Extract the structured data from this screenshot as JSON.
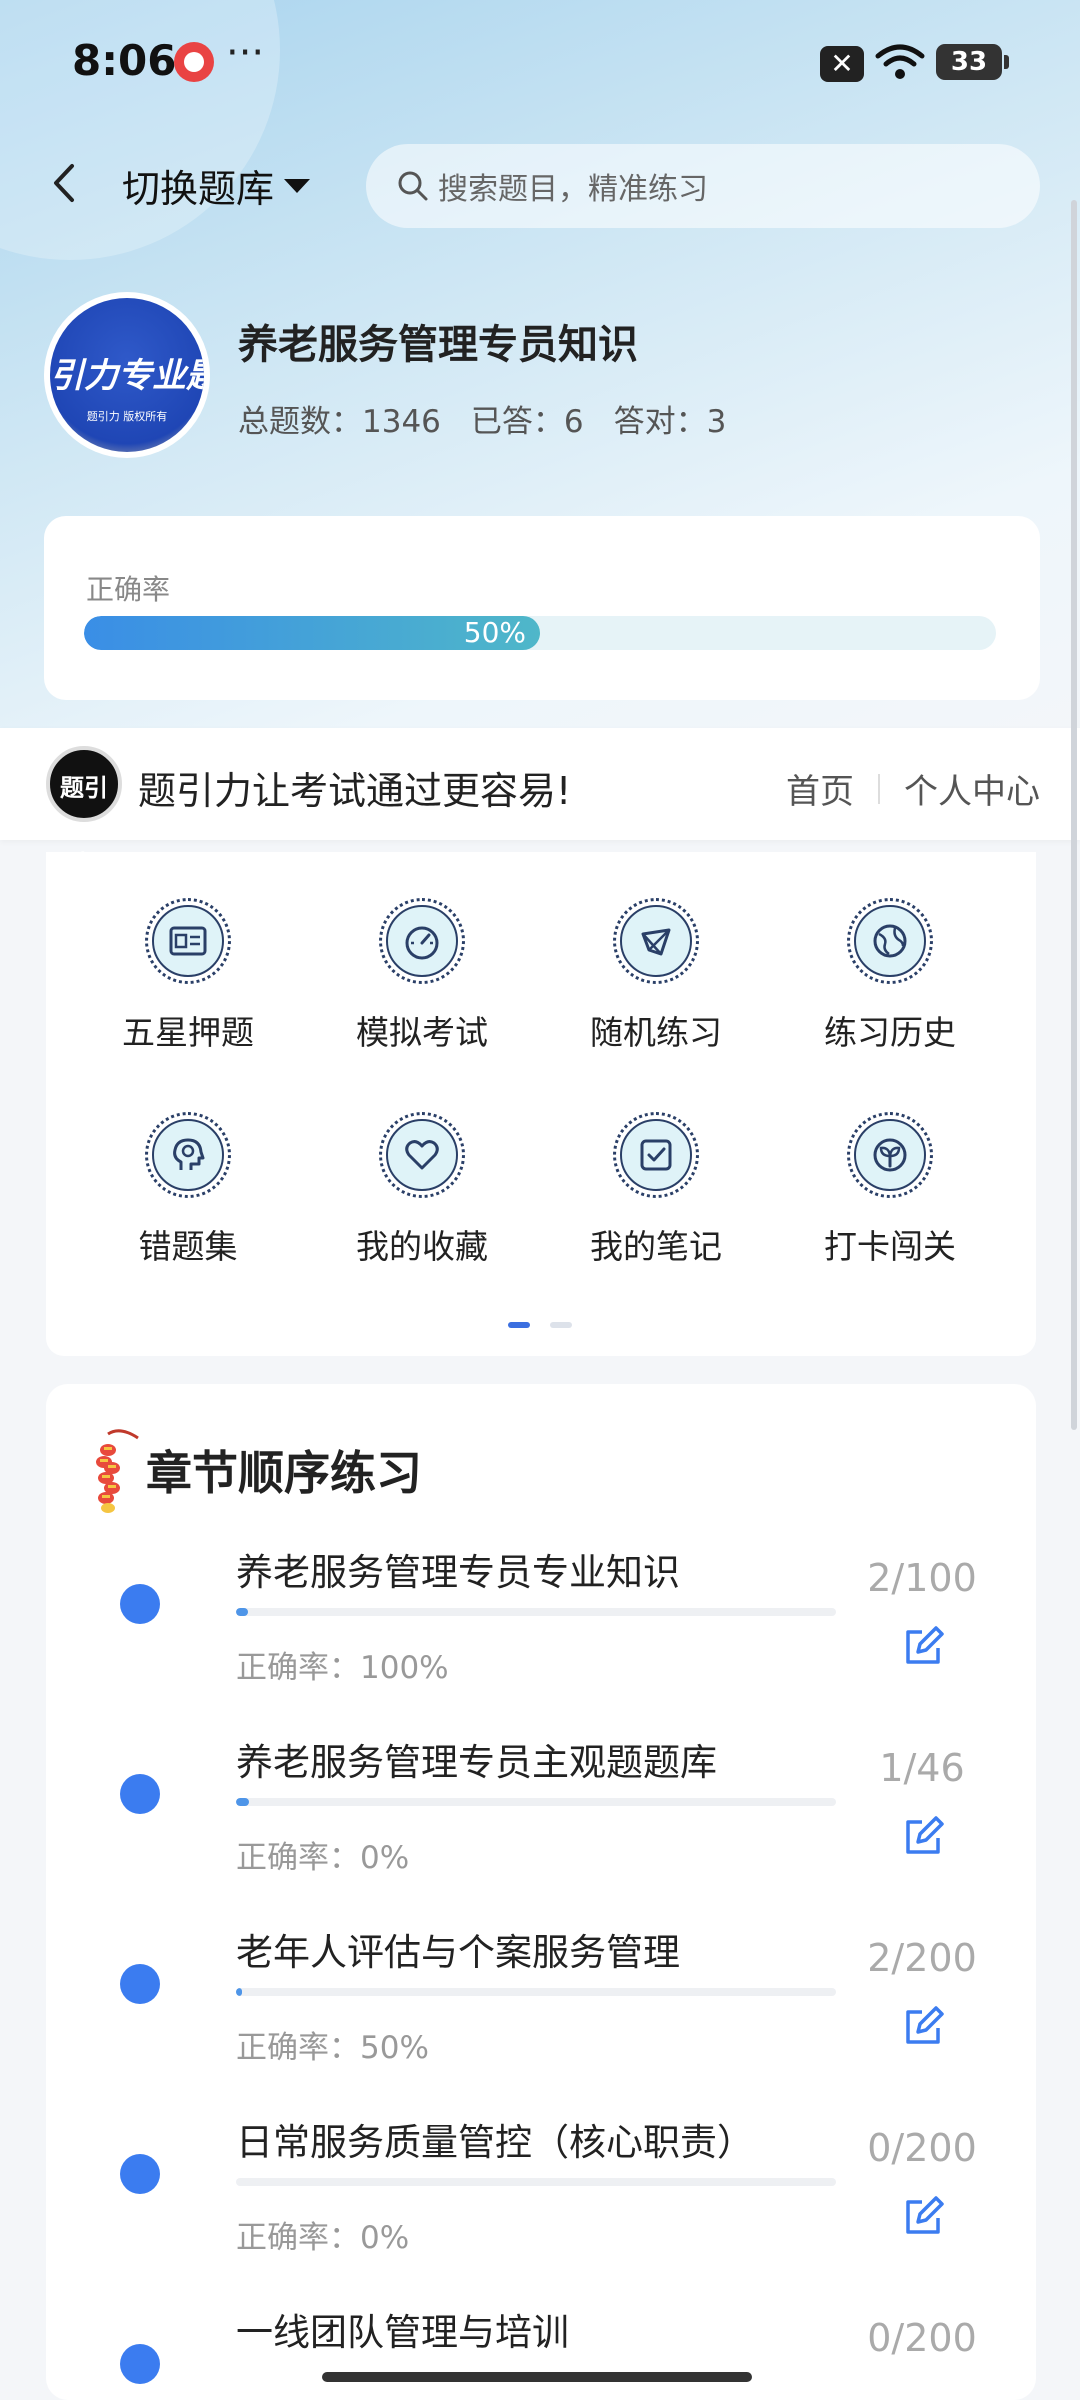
{
  "status_bar": {
    "time": "8:06",
    "more": "···",
    "battery": "33"
  },
  "header": {
    "switch_label": "切换题库",
    "search_placeholder": "搜索题目，精准练习"
  },
  "book": {
    "logo_text": "引力专业题",
    "logo_sub": "题引力 版权所有",
    "title": "养老服务管理专员知识",
    "total": "总题数：1346",
    "answered": "已答：6",
    "correct": "答对：3"
  },
  "accuracy": {
    "label": "正确率",
    "percent_text": "50%",
    "value": 0.5
  },
  "banner": {
    "brand_logo": "题引力",
    "slogan": "题引力让考试通过更容易!",
    "nav_home": "首页",
    "nav_profile": "个人中心"
  },
  "grid": {
    "items": [
      {
        "label": "五星押题",
        "icon": "id-card-icon"
      },
      {
        "label": "模拟考试",
        "icon": "speedometer-icon"
      },
      {
        "label": "随机练习",
        "icon": "network-icon"
      },
      {
        "label": "练习历史",
        "icon": "globe-icon"
      },
      {
        "label": "错题集",
        "icon": "head-icon"
      },
      {
        "label": "我的收藏",
        "icon": "heart-icon"
      },
      {
        "label": "我的笔记",
        "icon": "note-check-icon"
      },
      {
        "label": "打卡闯关",
        "icon": "sprout-icon"
      }
    ]
  },
  "chapters": {
    "title": "章节顺序练习",
    "items": [
      {
        "name": "养老服务管理专员专业知识",
        "rate": "正确率：100%",
        "count": "2/100",
        "progress": 0.02
      },
      {
        "name": "养老服务管理专员主观题题库",
        "rate": "正确率：0%",
        "count": "1/46",
        "progress": 0.022
      },
      {
        "name": "老年人评估与个案服务管理",
        "rate": "正确率：50%",
        "count": "2/200",
        "progress": 0.01
      },
      {
        "name": "日常服务质量管控（核心职责）",
        "rate": "正确率：0%",
        "count": "0/200",
        "progress": 0
      },
      {
        "name": "一线团队管理与培训",
        "rate": "",
        "count": "0/200",
        "progress": 0
      }
    ]
  },
  "colors": {
    "accent": "#3b7cf0",
    "progress_start": "#3a8ee6",
    "progress_end": "#4fb7c9",
    "icon_fill": "#dff3f8",
    "icon_stroke": "#2a3f67"
  }
}
